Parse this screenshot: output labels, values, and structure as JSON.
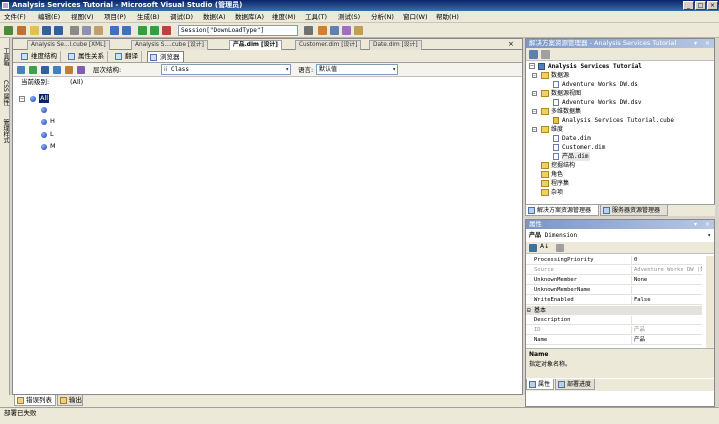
{
  "window": {
    "title": "Analysis Services Tutorial - Microsoft Visual Studio (管理员)",
    "minimize": "_",
    "maximize": "□",
    "close": "×"
  },
  "menu": [
    "文件(F)",
    "编辑(E)",
    "视图(V)",
    "项目(P)",
    "生成(B)",
    "调试(D)",
    "数据(A)",
    "数据库(A)",
    "维度(M)",
    "工具(T)",
    "测试(S)",
    "分析(N)",
    "窗口(W)",
    "帮助(H)"
  ],
  "toolbar": {
    "debug_combo": "Session[\"DownLoadType\"]"
  },
  "left_panel_tabs": [
    "工具箱",
    "CSS 属性",
    "管理样式"
  ],
  "doc_tabs": [
    "Analysis Se...l.cube [XML]",
    "Analysis S....cube [设计]",
    "产品.dim [设计]",
    "Customer.dim [设计]",
    "Date.dim [设计]"
  ],
  "designer_tabs": [
    "维度结构",
    "属性关系",
    "翻译",
    "浏览器"
  ],
  "browser": {
    "hierarchy_label": "层次结构:",
    "hierarchy_value": "Class",
    "language_label": "语言:",
    "language_value": "默认值",
    "level_label": "当前级别:",
    "level_value": "(All)",
    "root": "All",
    "members": [
      "",
      "H",
      "L",
      "M"
    ]
  },
  "bottom_tabs": [
    "错误列表",
    "输出"
  ],
  "status": "部署已失败",
  "solution_explorer": {
    "title": "解决方案资源管理器 - Analysis Services Tutorial",
    "project": "Analysis Services Tutorial",
    "folders": [
      {
        "name": "数据源",
        "items": [
          "Adventure Works DW.ds"
        ]
      },
      {
        "name": "数据源视图",
        "items": [
          "Adventure Works DW.dsv"
        ]
      },
      {
        "name": "多维数据集",
        "items": [
          "Analysis Services Tutorial.cube"
        ]
      },
      {
        "name": "维度",
        "items": [
          "Date.dim",
          "Customer.dim",
          "产品.dim"
        ]
      },
      {
        "name": "挖掘结构",
        "items": []
      },
      {
        "name": "角色",
        "items": []
      },
      {
        "name": "程序集",
        "items": []
      },
      {
        "name": "杂项",
        "items": []
      }
    ],
    "tabs": [
      "解决方案资源管理器",
      "服务器资源管理器"
    ]
  },
  "properties": {
    "title": "属性",
    "object": "产品",
    "object_type": "Dimension",
    "rows": [
      {
        "k": "ProcessingPriority",
        "v": "0",
        "grey": false
      },
      {
        "k": "Source",
        "v": "Adventure Works DW (数",
        "grey": true
      },
      {
        "k": "UnknownMember",
        "v": "None",
        "grey": false
      },
      {
        "k": "UnknownMemberName",
        "v": "",
        "grey": false
      },
      {
        "k": "WriteEnabled",
        "v": "False",
        "grey": false
      }
    ],
    "category": "基本",
    "rows2": [
      {
        "k": "Description",
        "v": "",
        "grey": false
      },
      {
        "k": "ID",
        "v": "产品",
        "grey": true
      },
      {
        "k": "Name",
        "v": "产品",
        "grey": false
      }
    ],
    "desc_title": "Name",
    "desc_text": "指定对象名称。",
    "tabs": [
      "属性",
      "部署进度"
    ]
  },
  "colors": {
    "title_bar": "#0a246a",
    "panel_title": "#7a96c8",
    "selected": "#0a246a"
  }
}
